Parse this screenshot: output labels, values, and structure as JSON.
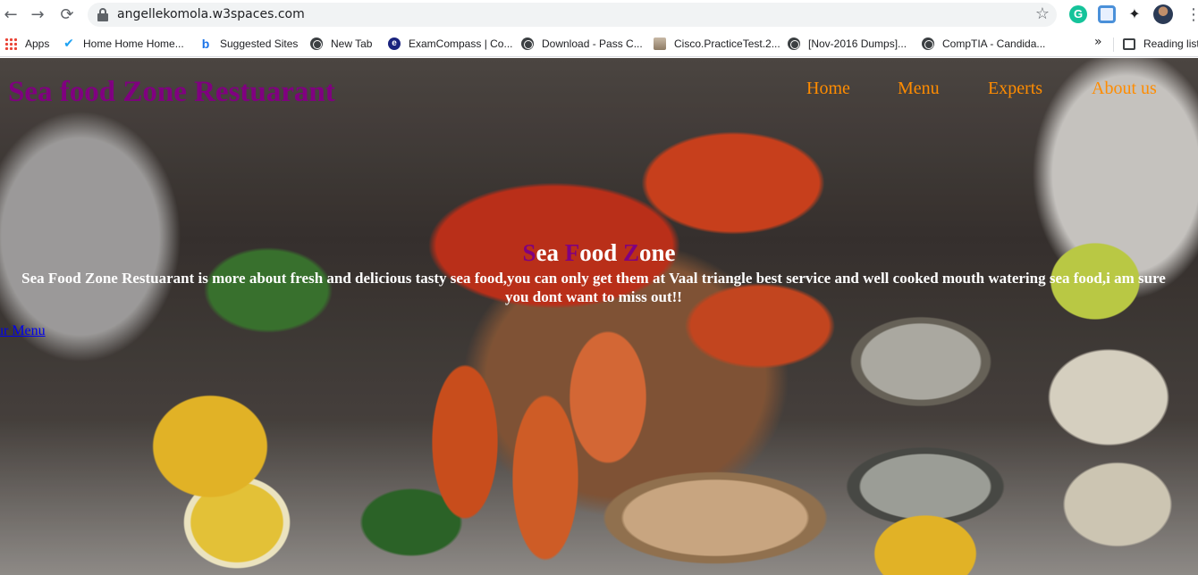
{
  "browser": {
    "url": "angellekomola.w3spaces.com",
    "nav_icons": [
      "back-arrow-icon",
      "forward-arrow-icon",
      "reload-icon"
    ],
    "bookmarks": [
      {
        "label": "Apps",
        "icon": "apps-grid-icon"
      },
      {
        "label": "Home Home Home...",
        "icon": "twitter-icon"
      },
      {
        "label": "Suggested Sites",
        "icon": "bing-icon"
      },
      {
        "label": "New Tab",
        "icon": "globe-icon"
      },
      {
        "label": "ExamCompass | Co...",
        "icon": "examcompass-icon"
      },
      {
        "label": "Download - Pass C...",
        "icon": "globe-icon"
      },
      {
        "label": "Cisco.PracticeTest.2...",
        "icon": "cisco-icon"
      },
      {
        "label": "[Nov-2016 Dumps]...",
        "icon": "globe-icon"
      },
      {
        "label": "CompTIA - Candida...",
        "icon": "globe-icon"
      }
    ],
    "more_bookmarks": "»",
    "reading_list": "Reading list",
    "extension_g": "G"
  },
  "site": {
    "title": "Sea food Zone Restuarant",
    "nav": [
      {
        "label": "Home"
      },
      {
        "label": "Menu"
      },
      {
        "label": "Experts"
      },
      {
        "label": "About us"
      }
    ],
    "tagline": [
      {
        "first": "S",
        "rest": "ea "
      },
      {
        "first": "F",
        "rest": "ood "
      },
      {
        "first": "Z",
        "rest": "one"
      }
    ],
    "intro": "Sea Food Zone Restuarant is more about fresh and delicious tasty sea food,you can only get them at Vaal triangle best service and well cooked mouth watering sea food,i am sure you dont want to miss out!!",
    "menu_link": "ur Menu"
  },
  "colors": {
    "title": "#800080",
    "nav": "#ff8c00",
    "tagline_highlight": "#800080",
    "text": "#ffffff",
    "link": "#0000ee"
  }
}
